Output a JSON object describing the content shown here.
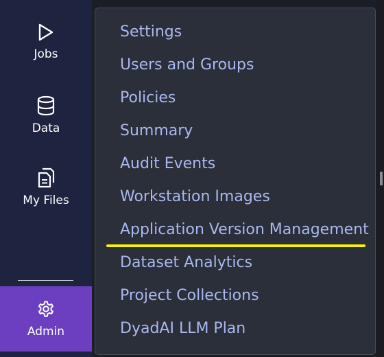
{
  "sidebar": {
    "items": [
      {
        "label": "Jobs",
        "icon": "play-icon"
      },
      {
        "label": "Data",
        "icon": "database-icon"
      },
      {
        "label": "My Files",
        "icon": "files-icon"
      }
    ],
    "admin": {
      "label": "Admin",
      "icon": "gear-icon",
      "active": true,
      "color": "#6b3fbf"
    }
  },
  "menu": {
    "items": [
      "Settings",
      "Users and Groups",
      "Policies",
      "Summary",
      "Audit Events",
      "Workstation Images",
      "Application Version Management",
      "Dataset Analytics",
      "Project Collections",
      "DyadAI LLM Plan"
    ],
    "highlighted_item": "Application Version Management",
    "highlight_color": "#f7f200",
    "item_color": "#aab8ee"
  }
}
